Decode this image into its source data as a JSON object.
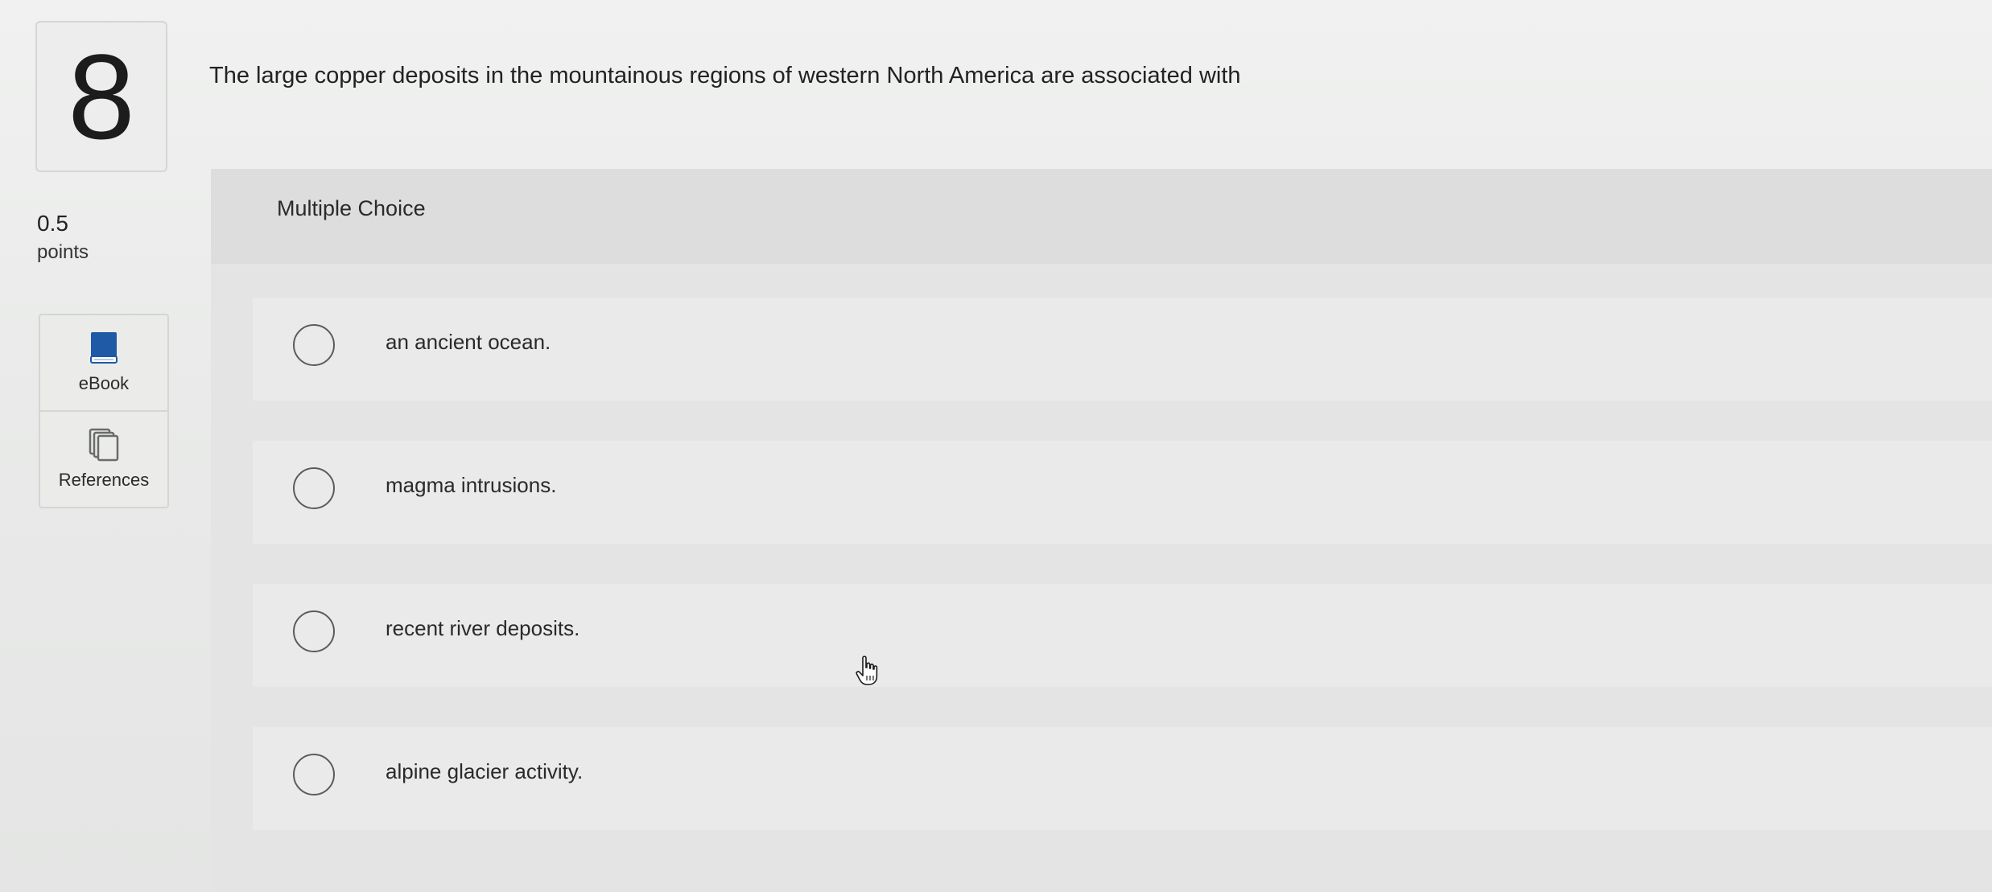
{
  "question": {
    "number": "8",
    "points_value": "0.5",
    "points_label": "points",
    "text": "The large copper deposits in the mountainous regions of western North America are associated with"
  },
  "tools": [
    {
      "label": "eBook",
      "icon": "book-icon"
    },
    {
      "label": "References",
      "icon": "references-icon"
    }
  ],
  "multiple_choice": {
    "title": "Multiple Choice",
    "options": [
      {
        "text": "an ancient ocean."
      },
      {
        "text": "magma intrusions."
      },
      {
        "text": "recent river deposits."
      },
      {
        "text": "alpine glacier activity."
      }
    ]
  },
  "colors": {
    "ebook_icon": "#1f5aa6",
    "references_icon": "#6a6c6a",
    "radio_border": "#5a5c5a"
  }
}
